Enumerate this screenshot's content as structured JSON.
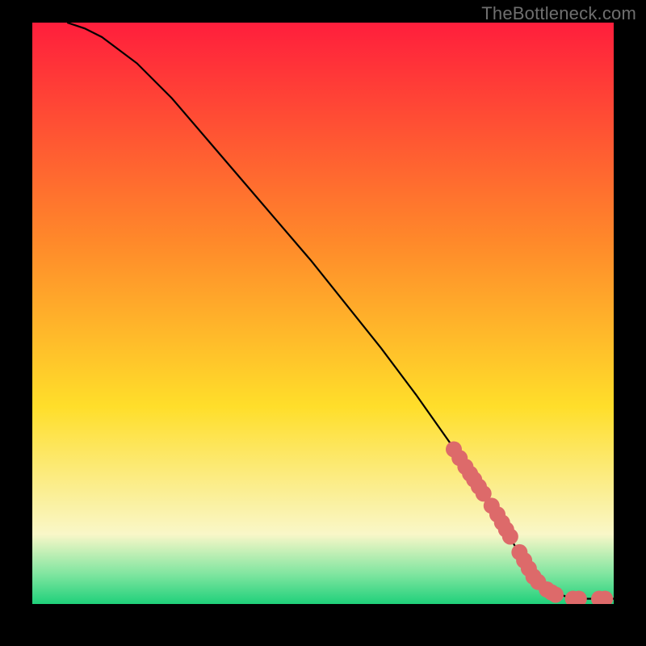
{
  "watermark": "TheBottleneck.com",
  "colors": {
    "gradient_top": "#ff1e3c",
    "gradient_warm": "#ff8a2a",
    "gradient_yellow": "#ffde2a",
    "gradient_pale": "#f9f7c8",
    "gradient_green_light": "#7de59f",
    "gradient_green": "#1fd07a",
    "curve": "#000000",
    "dot": "#dd6a6a",
    "frame": "#000000"
  },
  "chart_data": {
    "type": "line",
    "title": "",
    "xlabel": "",
    "ylabel": "",
    "xlim": [
      0,
      100
    ],
    "ylim": [
      0,
      100
    ],
    "grid": false,
    "legend": false,
    "curve": {
      "name": "bottleneck-curve",
      "x": [
        6,
        9,
        12,
        18,
        24,
        30,
        36,
        42,
        48,
        54,
        60,
        66,
        72,
        76,
        80,
        83,
        86,
        88,
        90,
        92,
        95,
        98,
        100
      ],
      "y": [
        100,
        99,
        97.5,
        93,
        87,
        80,
        73,
        66,
        59,
        51.5,
        44,
        36,
        27.5,
        21,
        15,
        10,
        6,
        3.5,
        2,
        1.2,
        0.9,
        0.9,
        0.9
      ]
    },
    "dots_along_curve": {
      "name": "markers",
      "x": [
        72.5,
        73.5,
        74.5,
        75.3,
        76.0,
        76.8,
        77.6,
        79.0,
        80.0,
        80.8,
        81.5,
        82.2,
        83.8,
        84.6,
        85.4,
        86.2,
        87.0,
        88.5,
        89.3,
        90.0,
        93.0,
        94.0,
        97.5,
        98.5
      ],
      "y": [
        26.6,
        25.1,
        23.6,
        22.4,
        21.4,
        20.2,
        19.0,
        16.9,
        15.4,
        14.0,
        12.8,
        11.6,
        8.9,
        7.5,
        6.1,
        4.7,
        3.8,
        2.5,
        2.0,
        1.6,
        0.9,
        0.9,
        0.9,
        0.9
      ]
    }
  }
}
